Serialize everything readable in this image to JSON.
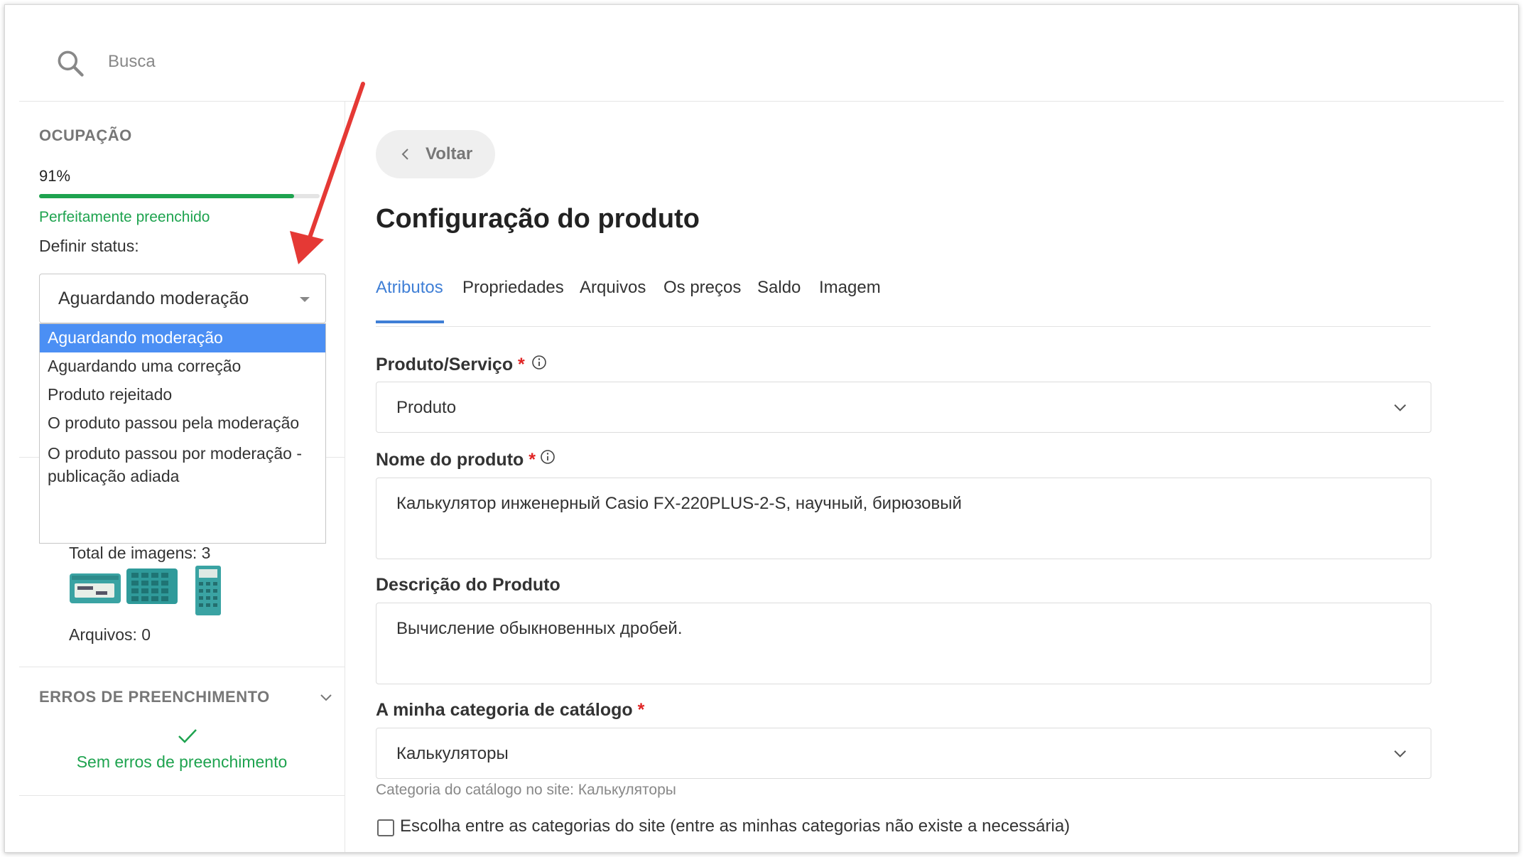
{
  "search": {
    "placeholder": "Busca",
    "icon": "search-icon"
  },
  "sidebar": {
    "occupancy_title": "OCUPAÇÃO",
    "occupancy_value": "91%",
    "occupancy_fraction": 0.91,
    "occupancy_status": "Perfeitamente preenchido",
    "status_label": "Definir status:",
    "status_selected": "Aguardando moderação",
    "status_options": [
      "Aguardando moderação",
      "Aguardando uma correção",
      "Produto rejeitado",
      "O produto passou pela moderação",
      "O produto passou por moderação -",
      "publicação adiada"
    ],
    "images_total": "Total de imagens: 3",
    "files_total": "Arquivos: 0",
    "errors_title": "ERROS DE PREENCHIMENTO",
    "errors_ok": "Sem erros de preenchimento"
  },
  "main": {
    "back_label": "Voltar",
    "title": "Configuração do produto",
    "tabs": [
      "Atributos",
      "Propriedades",
      "Arquivos",
      "Os preços",
      "Saldo",
      "Imagem"
    ],
    "active_tab": "Atributos",
    "fields": {
      "product_type_label": "Produto/Serviço",
      "product_type_value": "Produto",
      "name_label": "Nome do produto",
      "name_value": "Калькулятор инженерный Casio FX-220PLUS-2-S, научный, бирюзовый",
      "description_label": "Descrição do Produto",
      "description_value": "Вычисление обыкновенных дробей.",
      "category_label": "A minha categoria de catálogo",
      "category_value": "Калькуляторы",
      "category_hint": "Categoria do catálogo no site: Калькуляторы",
      "choose_site_category": "Escolha entre as categorias do site (entre as minhas categorias não existe a necessária)"
    },
    "required_mark": "*"
  },
  "colors": {
    "accent": "#3f7fd6",
    "success": "#1ea34f",
    "selection": "#4b8ff4",
    "required": "#e02424",
    "annotation_arrow": "#e53935"
  }
}
